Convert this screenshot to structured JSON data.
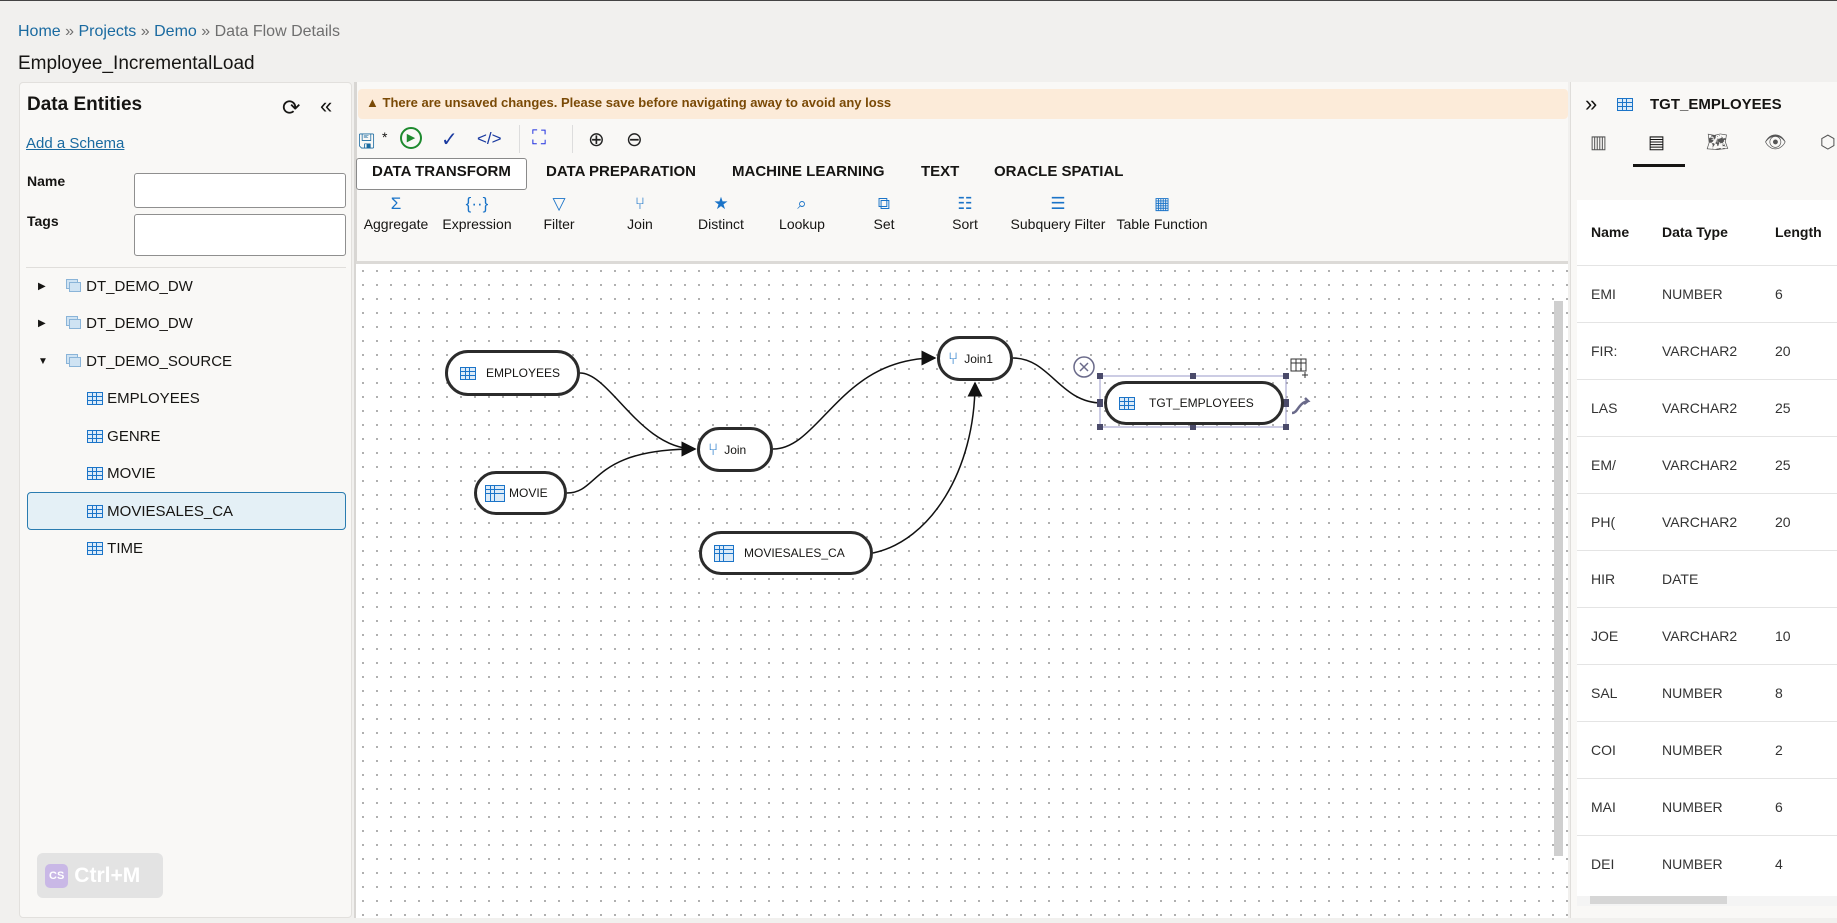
{
  "breadcrumb": {
    "items": [
      "Home",
      "Projects",
      "Demo"
    ],
    "current": "Data Flow Details",
    "sep": "»"
  },
  "page_title": "Employee_IncrementalLoad",
  "left": {
    "title": "Data Entities",
    "add_schema": "Add a Schema",
    "name_label": "Name",
    "tags_label": "Tags",
    "name_value": "",
    "tags_value": "",
    "schemas": [
      {
        "label": "DT_DEMO_DW",
        "expanded": false
      },
      {
        "label": "DT_DEMO_DW",
        "expanded": false
      },
      {
        "label": "DT_DEMO_SOURCE",
        "expanded": true
      }
    ],
    "entities": [
      "EMPLOYEES",
      "GENRE",
      "MOVIE",
      "MOVIESALES_CA",
      "TIME"
    ],
    "selected": "MOVIESALES_CA",
    "shortcut": "Ctrl+M",
    "shortcut_badge": "CS"
  },
  "warning": "There are unsaved changes. Please save before navigating away to avoid any loss",
  "toolbar": {
    "dirty_marker": "*"
  },
  "tabs": [
    "DATA TRANSFORM",
    "DATA PREPARATION",
    "MACHINE LEARNING",
    "TEXT",
    "ORACLE SPATIAL"
  ],
  "tools": [
    {
      "label": "Aggregate",
      "icon": "Σ"
    },
    {
      "label": "Expression",
      "icon": "{··}"
    },
    {
      "label": "Filter",
      "icon": "▽"
    },
    {
      "label": "Join",
      "icon": "⑂"
    },
    {
      "label": "Distinct",
      "icon": "★"
    },
    {
      "label": "Lookup",
      "icon": "⌕"
    },
    {
      "label": "Set",
      "icon": "⧉"
    },
    {
      "label": "Sort",
      "icon": "☷"
    },
    {
      "label": "Subquery Filter",
      "icon": "☰"
    },
    {
      "label": "Table Function",
      "icon": "▦"
    }
  ],
  "nodes": {
    "employees": "EMPLOYEES",
    "movie": "MOVIE",
    "join": "Join",
    "moviesales": "MOVIESALES_CA",
    "join1": "Join1",
    "target": "TGT_EMPLOYEES"
  },
  "right": {
    "title": "TGT_EMPLOYEES",
    "columns": [
      "Name",
      "Data Type",
      "Length"
    ],
    "rows": [
      [
        "EMI",
        "NUMBER",
        "6"
      ],
      [
        "FIR:",
        "VARCHAR2",
        "20"
      ],
      [
        "LAS",
        "VARCHAR2",
        "25"
      ],
      [
        "EM/",
        "VARCHAR2",
        "25"
      ],
      [
        "PH(",
        "VARCHAR2",
        "20"
      ],
      [
        "HIR",
        "DATE",
        ""
      ],
      [
        "JOE",
        "VARCHAR2",
        "10"
      ],
      [
        "SAL",
        "NUMBER",
        "8"
      ],
      [
        "COI",
        "NUMBER",
        "2"
      ],
      [
        "MAI",
        "NUMBER",
        "6"
      ],
      [
        "DEI",
        "NUMBER",
        "4"
      ]
    ]
  }
}
